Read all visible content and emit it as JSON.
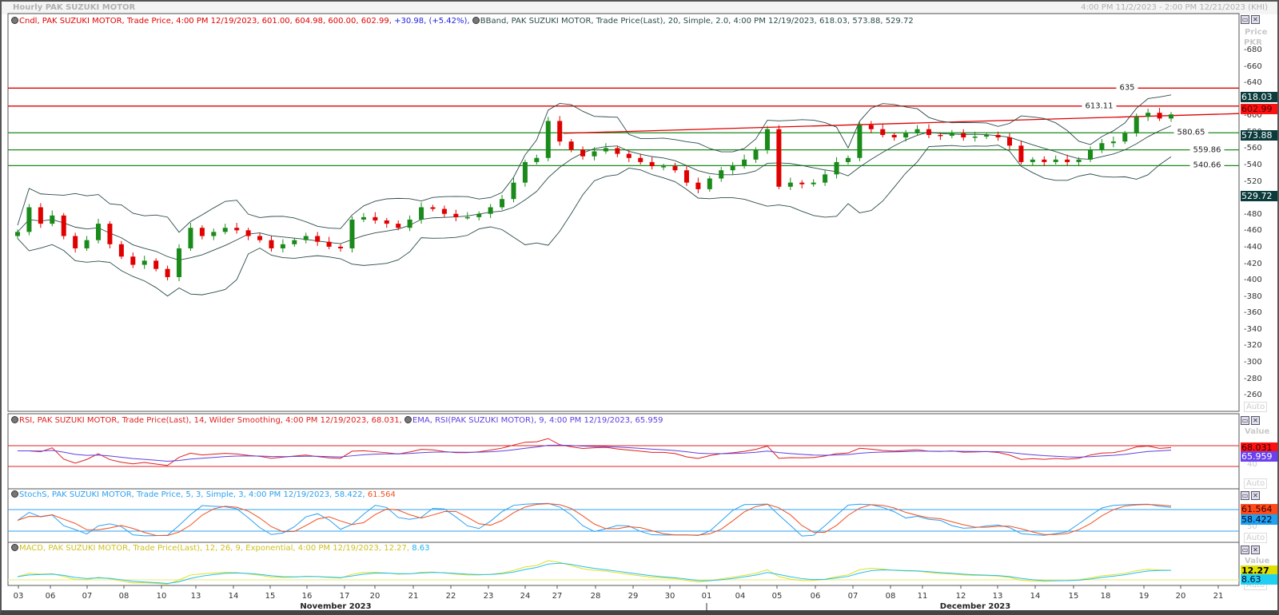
{
  "window": {
    "title": "Hourly PAK SUZUKI MOTOR",
    "range": "4:00 PM 11/2/2023 - 2:00 PM 12/21/2023 (KHI)"
  },
  "legends": {
    "candle": {
      "text": "Cndl, PAK SUZUKI MOTOR, Trade Price,  4:00 PM 12/19/2023, 601.00, 604.98, 600.00, 602.99, ",
      "change": "+30.98, (+5.42%),"
    },
    "bband": "BBand, PAK SUZUKI MOTOR, Trade Price(Last),  20, Simple, 2.0,  4:00 PM 12/19/2023, 618.03, 573.88, 529.72",
    "rsi": "RSI, PAK SUZUKI MOTOR, Trade Price(Last),  14, Wilder Smoothing,  4:00 PM 12/19/2023, 68.031, ",
    "rsi_ema": "EMA, RSI(PAK SUZUKI MOTOR),  9,  4:00 PM 12/19/2023, 65.959",
    "stoch": "StochS, PAK SUZUKI MOTOR, Trade Price,  5, 3, Simple, 3,  4:00 PM 12/19/2023, 58.422, ",
    "stoch_d": "61.564",
    "macd": "MACD, PAK SUZUKI MOTOR, Trade Price(Last),  12, 26, 9, Exponential,  4:00 PM 12/19/2023, 12.27, ",
    "macd_sig": "8.63"
  },
  "axis": {
    "price_title": "Price",
    "currency": "PKR",
    "value_title": "Value",
    "auto": "Auto",
    "rsi_mid": "40",
    "stoch_mid": "50"
  },
  "badges": {
    "bb_upper": "618.03",
    "last": "602.99",
    "bb_mid": "573.88",
    "bb_lower": "529.72",
    "rsi": "68.031",
    "rsi_ema": "65.959",
    "stoch_d": "61.564",
    "stoch_k": "58.422",
    "macd": "12.27",
    "macd_signal": "8.63"
  },
  "colors": {
    "up": "#1a8a1a",
    "down": "#e00000",
    "bband": "#2c4a4a",
    "rsi": "#e02020",
    "rsi_ema": "#6040e0",
    "stoch_k": "#2aa0f0",
    "stoch_d": "#f05020",
    "macd": "#e0e020",
    "macd_sig": "#20c0f0",
    "level_red": "#e00000",
    "level_green": "#1a8a1a"
  },
  "chart_data": {
    "type": "candlestick",
    "title": "Hourly PAK SUZUKI MOTOR",
    "ylabel": "Price PKR",
    "ylim": [
      250,
      690
    ],
    "yticks": [
      260,
      280,
      300,
      320,
      340,
      360,
      380,
      400,
      420,
      440,
      460,
      480,
      500,
      520,
      540,
      560,
      580,
      600,
      620,
      640,
      660,
      680
    ],
    "levels": [
      {
        "value": 635,
        "label": "635",
        "color": "red"
      },
      {
        "value": 613.11,
        "label": "613.11",
        "color": "red"
      },
      {
        "value": 580.65,
        "label": "580.65",
        "color": "green"
      },
      {
        "value": 559.86,
        "label": "559.86",
        "color": "green"
      },
      {
        "value": 540.66,
        "label": "540.66",
        "color": "green"
      }
    ],
    "trendline": {
      "from": 580,
      "to": 604
    },
    "x_ticks": [
      "03",
      "06",
      "07",
      "08",
      "10",
      "13",
      "14",
      "15",
      "16",
      "17",
      "20",
      "21",
      "22",
      "23",
      "24",
      "27",
      "28",
      "29",
      "30",
      "01",
      "04",
      "05",
      "06",
      "07",
      "08",
      "11",
      "12",
      "13",
      "14",
      "15",
      "18",
      "19",
      "20",
      "21"
    ],
    "months": [
      "November 2023",
      "December 2023"
    ],
    "closes": [
      460,
      490,
      470,
      480,
      455,
      440,
      450,
      470,
      445,
      430,
      420,
      425,
      415,
      405,
      440,
      465,
      455,
      460,
      465,
      462,
      455,
      450,
      440,
      445,
      450,
      455,
      448,
      442,
      440,
      475,
      478,
      474,
      470,
      465,
      475,
      490,
      488,
      482,
      478,
      478,
      482,
      490,
      500,
      520,
      545,
      550,
      595,
      570,
      560,
      552,
      558,
      562,
      555,
      550,
      545,
      540,
      540,
      535,
      520,
      512,
      525,
      535,
      540,
      548,
      560,
      585,
      515,
      520,
      518,
      520,
      530,
      545,
      550,
      590,
      585,
      578,
      575,
      580,
      585,
      578,
      577,
      580,
      575,
      576,
      578,
      575,
      565,
      545,
      548,
      545,
      548,
      545,
      548,
      560,
      568,
      570,
      580,
      600,
      605,
      598,
      603
    ]
  }
}
